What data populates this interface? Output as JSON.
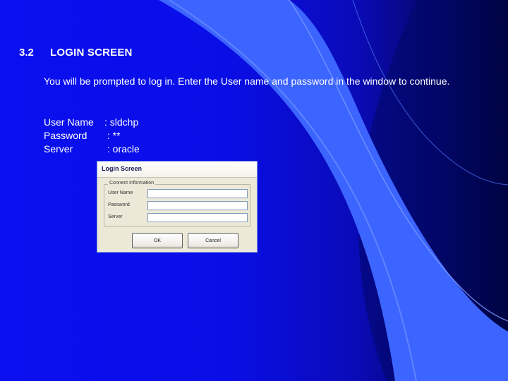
{
  "slide": {
    "number": "3.2",
    "title": "LOGIN SCREEN",
    "intro": "You will be prompted to log in. Enter the User name and password in the window to continue.",
    "credentials": [
      {
        "label": "User Name",
        "value": ": sldchp"
      },
      {
        "label": "Password",
        "value": " : **"
      },
      {
        "label": "Server",
        "value": " : oracle"
      }
    ]
  },
  "login_window": {
    "title": "Login Screen",
    "group_label": "Connect Information",
    "fields": [
      {
        "label": "User Name",
        "value": ""
      },
      {
        "label": "Password",
        "value": ""
      },
      {
        "label": "Server",
        "value": ""
      }
    ],
    "ok_label": "OK",
    "cancel_label": "Cancel"
  },
  "colors": {
    "background_left": "#0a0ff0",
    "background_right": "#000018",
    "accent_swoosh": "#3c64ff"
  }
}
